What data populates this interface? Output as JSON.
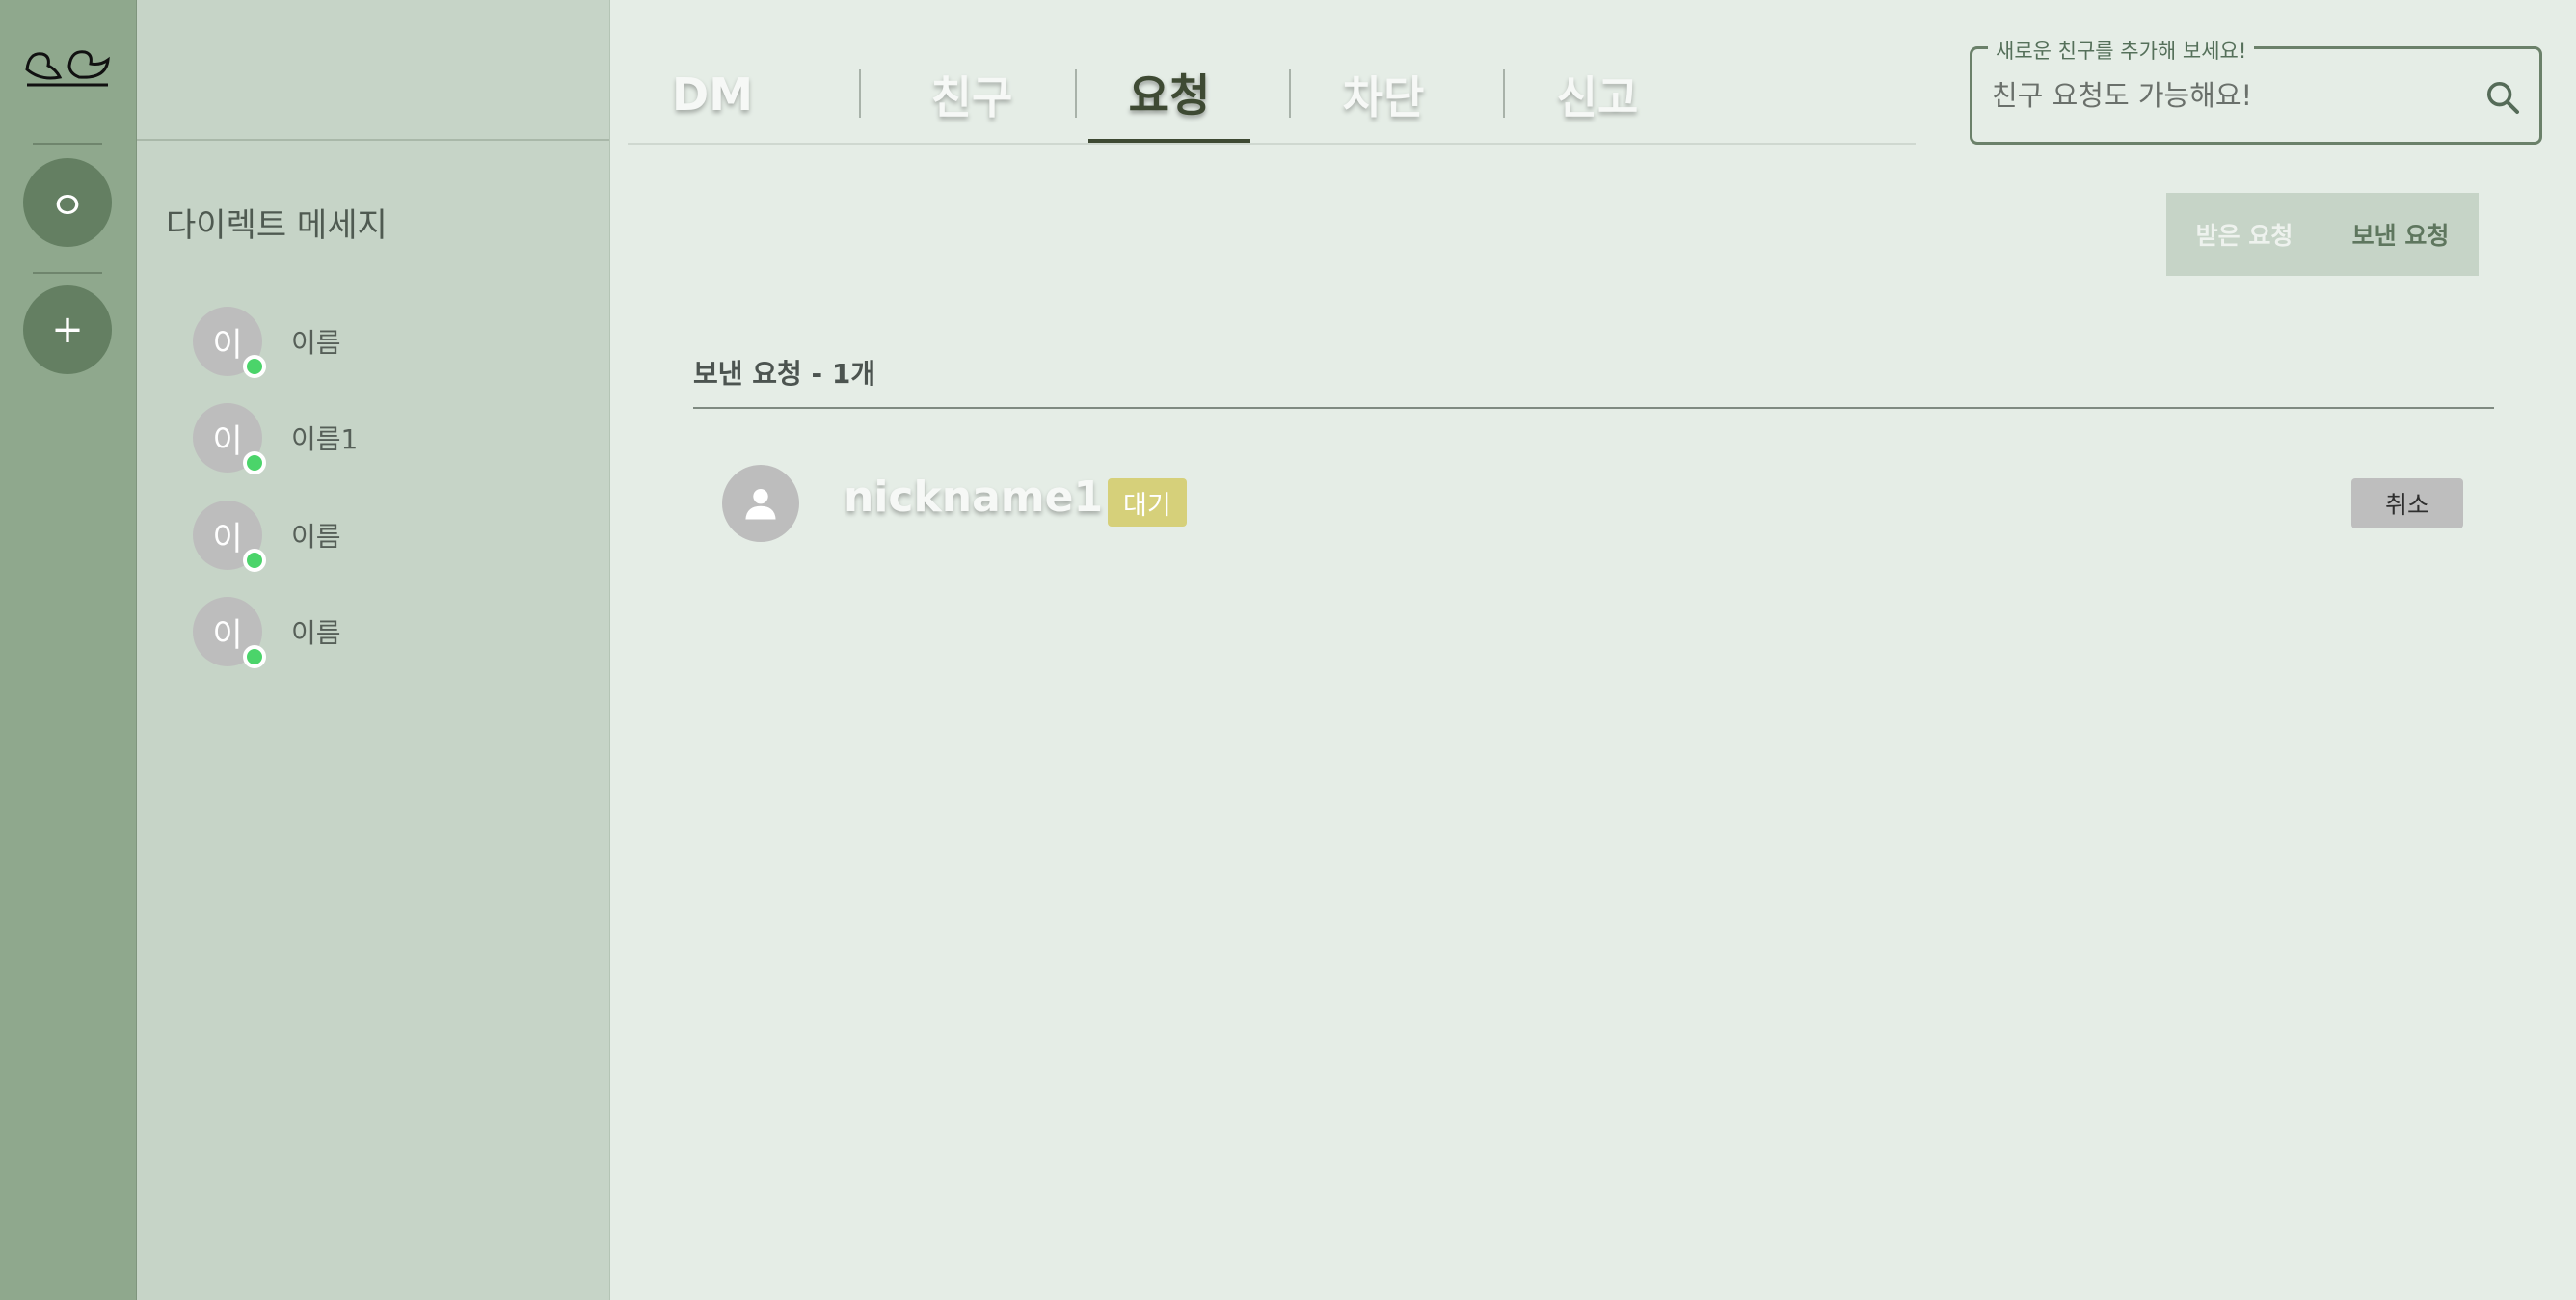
{
  "rail": {
    "logo_icon": "two-birds-logo",
    "profile_label": "ㅇ",
    "add_label": "+"
  },
  "dm": {
    "title": "다이렉트 메세지",
    "items": [
      {
        "avatar": "이",
        "name": "이름",
        "status": "online"
      },
      {
        "avatar": "이",
        "name": "이름1",
        "status": "online"
      },
      {
        "avatar": "이",
        "name": "이름",
        "status": "online"
      },
      {
        "avatar": "이",
        "name": "이름",
        "status": "online"
      }
    ]
  },
  "tabs": [
    {
      "label": "DM"
    },
    {
      "label": "친구"
    },
    {
      "label": "요청",
      "active": true
    },
    {
      "label": "차단"
    },
    {
      "label": "신고"
    }
  ],
  "search": {
    "legend": "새로운 친구를 추가해 보세요!",
    "placeholder": "친구 요청도 가능해요!",
    "icon": "search-icon"
  },
  "toggle": {
    "received_label": "받은 요청",
    "sent_label": "보낸 요청",
    "selected": "sent"
  },
  "section": {
    "title": "보낸 요청 - 1개"
  },
  "requests": [
    {
      "nickname": "nickname1",
      "badge": "대기",
      "cancel_label": "취소",
      "avatar_icon": "person-icon"
    }
  ],
  "colors": {
    "rail": "#8fa88d",
    "sidebar": "#c6d4c7",
    "main": "#e5ede6",
    "accent": "#3e4a33",
    "online": "#4bd46a",
    "badge": "#d6d07a"
  }
}
